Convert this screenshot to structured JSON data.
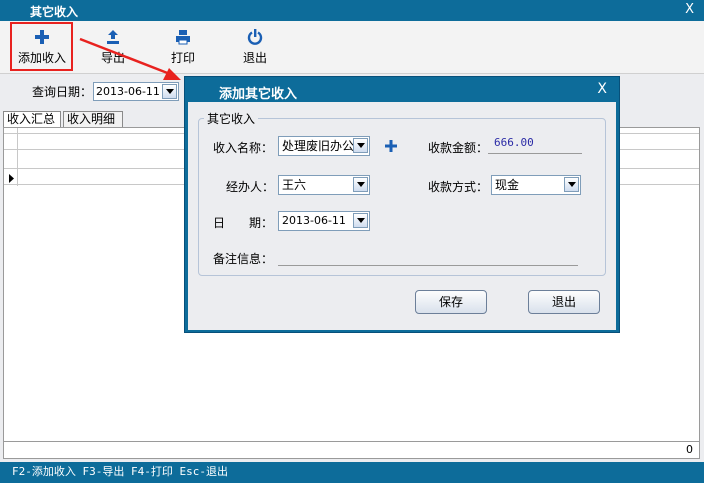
{
  "window": {
    "title": "其它收入",
    "close_glyph": "X"
  },
  "toolbar": {
    "add_label": "添加收入",
    "export_label": "导出",
    "print_label": "打印",
    "exit_label": "退出"
  },
  "query": {
    "date_label": "查询日期：",
    "date_value": "2013-06-11"
  },
  "tabs": [
    {
      "label": "收入汇总"
    },
    {
      "label": "收入明细"
    }
  ],
  "grid": {
    "footer_total": "0"
  },
  "statusbar": {
    "text": "F2-添加收入 F3-导出 F4-打印 Esc-退出"
  },
  "dialog": {
    "title": "添加其它收入",
    "close_glyph": "X",
    "group_label": "其它收入",
    "name_label": "收入名称：",
    "name_value": "处理废旧办公",
    "amount_label": "收款金额：",
    "amount_value": "666.00",
    "handler_label": "经办人：",
    "handler_value": "王六",
    "method_label": "收款方式：",
    "method_value": "现金",
    "date_label": "日　　期：",
    "date_value": "2013-06-11",
    "memo_label": "备注信息：",
    "save_label": "保存",
    "exit_label": "退出"
  },
  "colors": {
    "titlebar": "#0d6c9a",
    "highlight": "#e8221f",
    "accent_plus": "#1a5fb4",
    "amount_text": "#2b2ba6"
  },
  "icons": {
    "add": "plus-icon",
    "export": "upload-icon",
    "print": "printer-icon",
    "exit": "power-icon"
  }
}
